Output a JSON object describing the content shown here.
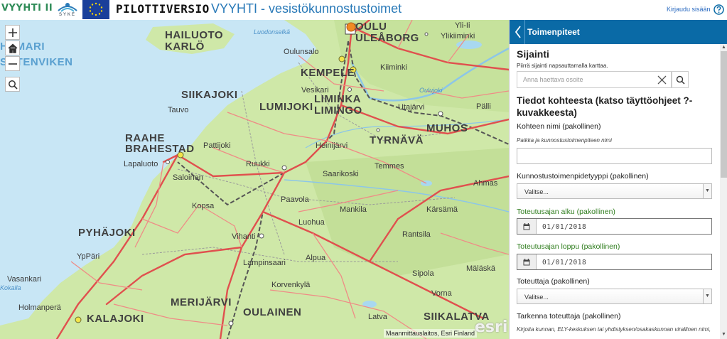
{
  "header": {
    "logo_text": "VYYHTI II",
    "syke_text": "SYKE",
    "pilot_label": "PILOTTIVERSIO",
    "title": "VYYHTI - vesistökunnostustoimet",
    "login_label": "Kirjaudu sisään",
    "help_icon": "help-circle-icon"
  },
  "map": {
    "controls": [
      "zoom-in-icon",
      "home-icon",
      "zoom-out-icon",
      "search-icon"
    ],
    "labels": {
      "hailuoto": "HAILUOTO",
      "karlo": "KARLÖ",
      "oulu": "OULU",
      "uleaborg": "ULEÅBORG",
      "yli_ii": "Yli-Ii",
      "ylikiiminki": "Ylikiiminki",
      "oulunsalo": "Oulunsalo",
      "kempele": "KEMPELE",
      "kiiminki": "Kiiminki",
      "vesikari": "Vesikari",
      "hamari": "HAMARI",
      "sotenviken": "SOTENVIKEN",
      "siikajoki": "SIIKAJOKI",
      "lumijoki": "LUMIJOKI",
      "liminka": "LIMINKA",
      "liminga": "LIMINGO",
      "utajarvi": "Utajärvi",
      "palli": "Pälli",
      "muhos": "MUHOS",
      "tauvo": "Tauvo",
      "raahe": "RAAHE",
      "brahestad": "BRAHESTAD",
      "pattijoki": "Pattijoki",
      "heinijarvi": "Heinijärvi",
      "tyrnava": "TYRNÄVÄ",
      "lapaluoto": "Lapaluoto",
      "ruukki": "Ruukki",
      "temmes": "Temmes",
      "ahmas": "Ahmas",
      "saloinen": "Saloinen",
      "saarikoski": "Saarikoski",
      "kopsa": "Kopsa",
      "paavola": "Paavola",
      "mankila": "Mankila",
      "karsama": "Kärsämä",
      "luohua": "Luohua",
      "pyhajoki": "PYHÄJOKI",
      "vihanti": "Vihanti",
      "rantsila": "Rantsila",
      "yppari": "YpPäri",
      "alpua": "Alpua",
      "lampinsaari": "Lampinsaari",
      "vasankari": "Vasankari",
      "korvenkyla": "Korvenkylä",
      "sipola": "Sipola",
      "malaska": "Mäläskä",
      "kokalla": "Kokalla",
      "merijarvi": "MERIJÄRVI",
      "vorna": "Vorna",
      "holmanpera": "Holmanperä",
      "kalajoki": "KALAJOKI",
      "oulainen": "OULAINEN",
      "latva": "Latva",
      "siikalatva": "SIIKALATVA",
      "ludenselka": "Luodonselkä",
      "oulujoki": "Oulujoki"
    },
    "attribution": "Maanmittauslaitos, Esri Finland",
    "esri_logo": "esri"
  },
  "panel": {
    "title": "Toimenpiteet",
    "location": {
      "heading": "Sijainti",
      "hint": "Piirrä sijainti napsauttamalla karttaa.",
      "search_placeholder": "Anna haettava osoite"
    },
    "details_heading": "Tiedot kohteesta (katso täyttöohjeet ?-kuvakkeesta)",
    "fields": {
      "name_label": "Kohteen nimi (pakollinen)",
      "name_hint": "Paikka ja kunnostustoimenpiteen nimi",
      "name_value": "",
      "type_label": "Kunnostustoimenpidetyyppi (pakollinen)",
      "type_value": "Valitse...",
      "start_label": "Toteutusajan alku (pakollinen)",
      "start_value": "01/01/2018",
      "end_label": "Toteutusajan loppu (pakollinen)",
      "end_value": "01/01/2018",
      "implementer_label": "Toteuttaja (pakollinen)",
      "implementer_value": "Valitse...",
      "detail_implementer_label": "Tarkenna toteuttaja (pakollinen)",
      "detail_implementer_hint": "Kirjoita kunnan, ELY-keskuksen tai yhdistyksen/osakaskunnan virallinen nimi,"
    }
  },
  "colors": {
    "panel_header": "#0a6aa6",
    "accent_green": "#2f7d1e",
    "map_land": "#cfe8a8",
    "map_sea": "#c8e6f5",
    "road_red": "#e0504e"
  }
}
